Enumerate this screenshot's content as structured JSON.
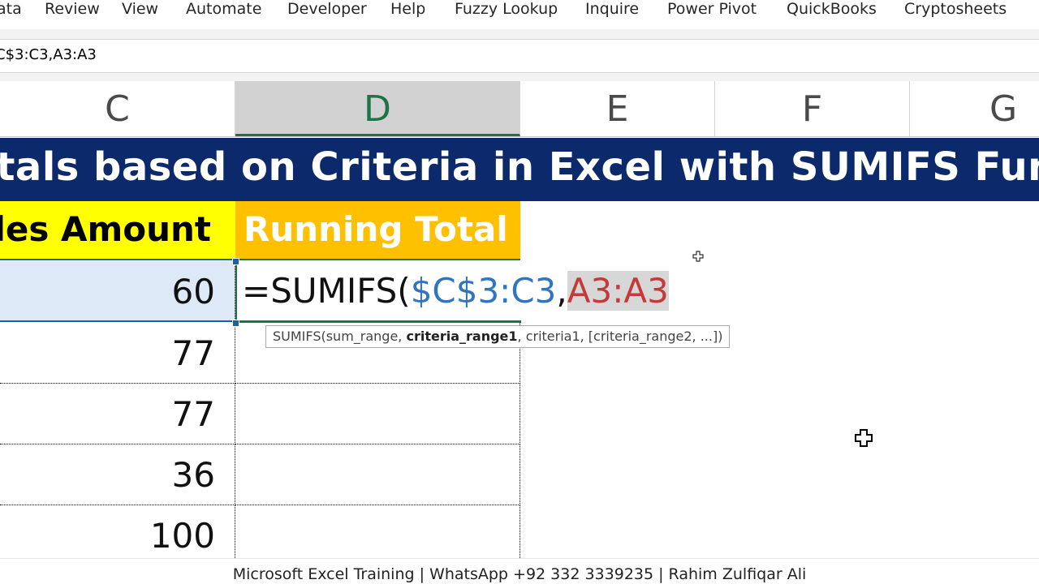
{
  "ribbon": {
    "tabs": [
      "ata",
      "Review",
      "View",
      "Automate",
      "Developer",
      "Help",
      "Fuzzy Lookup",
      "Inquire",
      "Power Pivot",
      "QuickBooks",
      "Cryptosheets"
    ]
  },
  "formula_bar": {
    "text": "C$3:C3,A3:A3"
  },
  "columns": [
    "C",
    "D",
    "E",
    "F",
    "G"
  ],
  "banner": {
    "title": "otals based on Criteria in Excel with SUMIFS Functio"
  },
  "headers": {
    "c": "les Amount",
    "d": "Running Total"
  },
  "rows": [
    {
      "c": "60"
    },
    {
      "c": "77"
    },
    {
      "c": "77"
    },
    {
      "c": "36"
    },
    {
      "c": "100"
    }
  ],
  "active_formula": {
    "prefix": "=SUMIFS(",
    "range1": "$C$3:C3",
    "comma": ",",
    "range2": "A3:A3"
  },
  "tooltip": {
    "part1": "SUMIFS(sum_range, ",
    "bold": "criteria_range1",
    "part2": ", criteria1, [criteria_range2, ...])"
  },
  "footer": {
    "text": "Microsoft Excel Training | WhatsApp +92 332 3339235 | Rahim Zulfiqar Ali"
  },
  "icons": {
    "cursor": "cross-cursor-icon"
  }
}
